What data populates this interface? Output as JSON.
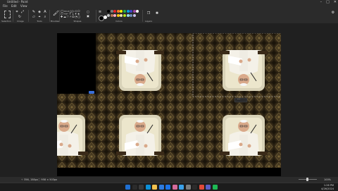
{
  "app": {
    "title": "Untitled - Paint",
    "window_controls": [
      "–",
      "□",
      "✕"
    ]
  },
  "menu": {
    "items": [
      "File",
      "Edit",
      "View"
    ]
  },
  "ribbon": {
    "groups": [
      {
        "name": "Selection"
      },
      {
        "name": "Image"
      },
      {
        "name": "Tools"
      },
      {
        "name": "Brushes"
      },
      {
        "name": "Shapes"
      },
      {
        "name": "Colors"
      },
      {
        "name": "Layers"
      }
    ],
    "palette": [
      "#000000",
      "#7f7f7f",
      "#ed1c24",
      "#ff7f27",
      "#fff200",
      "#22b14c",
      "#00a2e8",
      "#3f48cc",
      "#a349a4",
      "#ffffff",
      "#c3c3c3",
      "#b97a57",
      "#ffaec9",
      "#ffc90e",
      "#efe4b0",
      "#b5e61d",
      "#99d9ea",
      "#7092be",
      "#c8bfe7"
    ]
  },
  "canvas": {
    "badge_text": "···"
  },
  "status": {
    "position": "⊹ 356, 158px",
    "selection": "⬚ 958 × 503px",
    "zoom": "100%"
  },
  "taskbar": {
    "time": "1:26 PM",
    "date": "4/26/2024",
    "icons": [
      "start-icon",
      "search-icon",
      "task-view-icon",
      "edge-icon",
      "files-icon",
      "store-icon",
      "mail-icon",
      "photos-icon",
      "paint-icon",
      "settings-icon",
      "terminal-icon",
      "chrome-icon",
      "teams-icon",
      "spotify-icon"
    ]
  }
}
